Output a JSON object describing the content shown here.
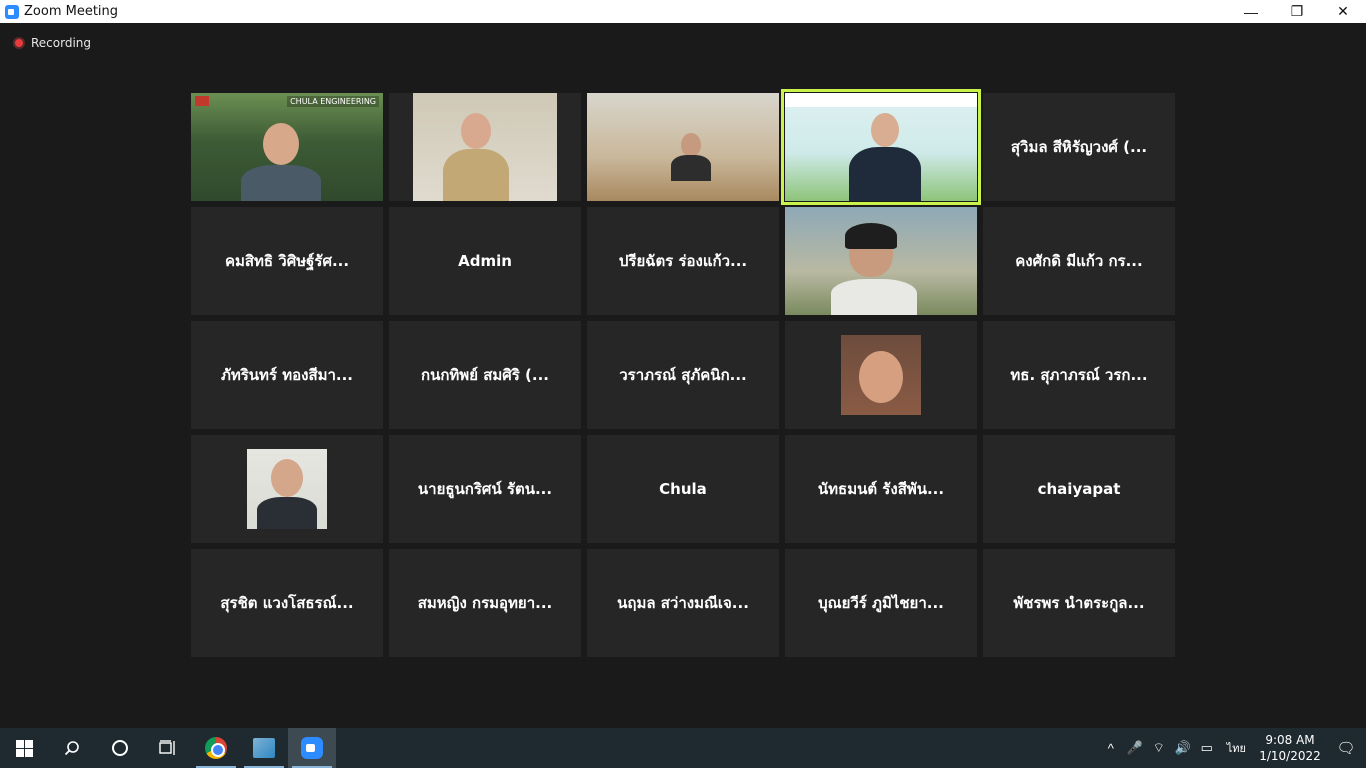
{
  "window": {
    "title": "Zoom Meeting",
    "controls": {
      "minimize": "—",
      "restore": "❐",
      "close": "✕"
    }
  },
  "recording": {
    "label": "Recording",
    "color": "#e83c3c"
  },
  "video_tiles": {
    "t1_banner": "CHULA ENGINEERING"
  },
  "participants": [
    "สุวิมล สีหิรัญวงศ์ (...",
    "คมสิทธิ วิศิษฐ์รัศ...",
    "Admin",
    "ปรียฉัตร ร่องแก้ว...",
    "คงศักดิ มีแก้ว กร...",
    "ภัทรินทร์ ทองสีมา...",
    "กนกทิพย์ สมศิริ (...",
    "วราภรณ์ สุภัคนิก...",
    "ทธ. สุภาภรณ์ วรก...",
    "นายธูนกริศน์ รัตน...",
    "Chula",
    "นัทธมนต์ รังสีพัน...",
    "chaiyapat",
    "สุรชิต แวงโสธรณ์...",
    "สมหญิง กรมอุทยา...",
    "นฤมล สว่างมณีเจ...",
    "บุณยวีร์ ภูมิไชยา...",
    "พัชรพร นำตระกูล..."
  ],
  "taskbar": {
    "icons": [
      "windows-icon",
      "search-icon",
      "cortana-icon",
      "task-view-icon",
      "chrome-icon",
      "app-icon",
      "zoom-icon"
    ],
    "tray": {
      "chevron": "^",
      "mic": "🎤",
      "wifi": "⌔",
      "volume": "🔊",
      "battery": "▭",
      "language": "ไทย",
      "time": "9:08 AM",
      "date": "1/10/2022",
      "notification": "🗨"
    }
  },
  "colors": {
    "active_speaker": "#c9f24a",
    "tile_bg": "#262626",
    "meeting_bg": "#1a1a1a"
  }
}
